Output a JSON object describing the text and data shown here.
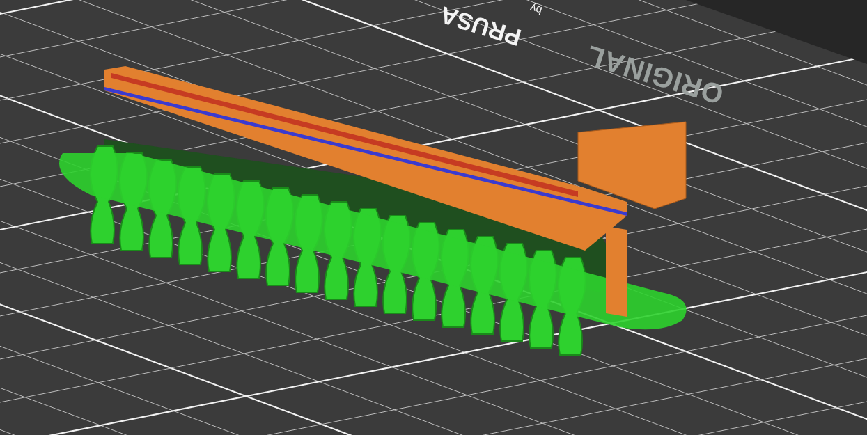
{
  "viewport": {
    "bed_logo": {
      "brand_top": "ORIGINAL",
      "brand_main": "PRUSA",
      "byline": "by"
    }
  }
}
